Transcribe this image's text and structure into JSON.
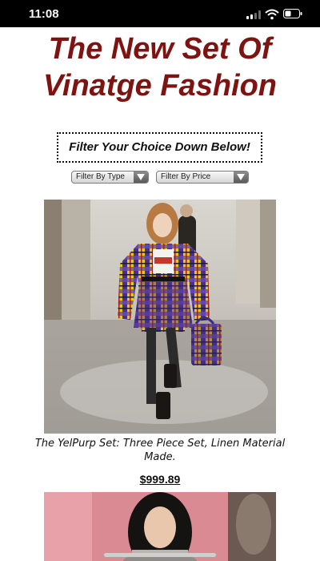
{
  "status_bar": {
    "time": "11:08",
    "icons": [
      "signal-icon",
      "wifi-icon",
      "battery-icon"
    ]
  },
  "headline": "The New Set Of Vinatge Fashion",
  "filter_box": {
    "text": "Filter Your Choice Down Below!"
  },
  "filters": [
    {
      "label": "Filter By Type",
      "icon": "dropdown-arrow-icon"
    },
    {
      "label": "Filter By Price",
      "icon": "dropdown-arrow-icon"
    }
  ],
  "products": [
    {
      "image": "runway model in yellow-purple plaid blazer and skirt set with matching bag",
      "caption": "The YelPurp Set: Three Piece Set, Linen Material Made.",
      "price": "$999.89"
    },
    {
      "image": "runway model with long dark hair in front of pink backdrop"
    }
  ],
  "colors": {
    "headline": "#7d1411",
    "status_bar_bg": "#000000",
    "page_bg": "#ffffff"
  }
}
